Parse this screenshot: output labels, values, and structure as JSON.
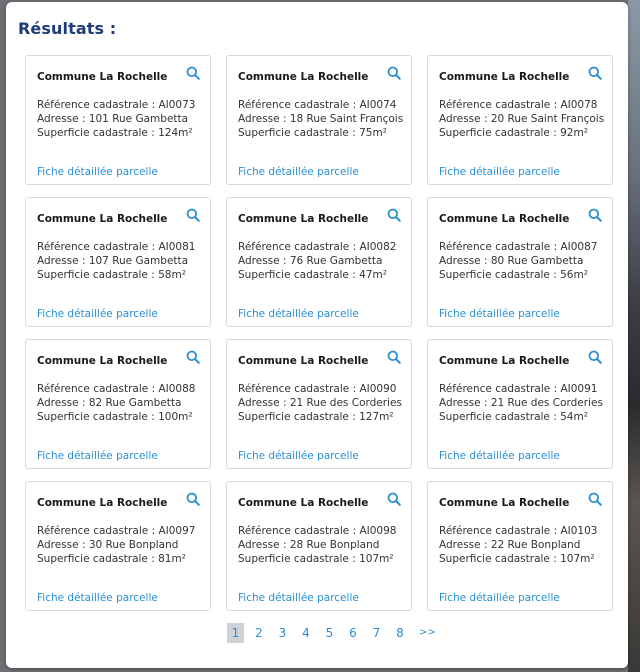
{
  "results": {
    "title": "Résultats :"
  },
  "cards": [
    {
      "commune": "Commune La Rochelle",
      "reference": "Référence cadastrale : AI0073",
      "adresse": "Adresse : 101 Rue Gambetta",
      "superficie": "Superficie cadastrale : 124m²",
      "link": "Fiche détaillée parcelle"
    },
    {
      "commune": "Commune La Rochelle",
      "reference": "Référence cadastrale : AI0074",
      "adresse": "Adresse : 18 Rue Saint François",
      "superficie": "Superficie cadastrale : 75m²",
      "link": "Fiche détaillée parcelle"
    },
    {
      "commune": "Commune La Rochelle",
      "reference": "Référence cadastrale : AI0078",
      "adresse": "Adresse : 20 Rue Saint François",
      "superficie": "Superficie cadastrale : 92m²",
      "link": "Fiche détaillée parcelle"
    },
    {
      "commune": "Commune La Rochelle",
      "reference": "Référence cadastrale : AI0081",
      "adresse": "Adresse : 107 Rue Gambetta",
      "superficie": "Superficie cadastrale : 58m²",
      "link": "Fiche détaillée parcelle"
    },
    {
      "commune": "Commune La Rochelle",
      "reference": "Référence cadastrale : AI0082",
      "adresse": "Adresse : 76 Rue Gambetta",
      "superficie": "Superficie cadastrale : 47m²",
      "link": "Fiche détaillée parcelle"
    },
    {
      "commune": "Commune La Rochelle",
      "reference": "Référence cadastrale : AI0087",
      "adresse": "Adresse : 80 Rue Gambetta",
      "superficie": "Superficie cadastrale : 56m²",
      "link": "Fiche détaillée parcelle"
    },
    {
      "commune": "Commune La Rochelle",
      "reference": "Référence cadastrale : AI0088",
      "adresse": "Adresse : 82 Rue Gambetta",
      "superficie": "Superficie cadastrale : 100m²",
      "link": "Fiche détaillée parcelle"
    },
    {
      "commune": "Commune La Rochelle",
      "reference": "Référence cadastrale : AI0090",
      "adresse": "Adresse : 21 Rue des Corderies",
      "superficie": "Superficie cadastrale : 127m²",
      "link": "Fiche détaillée parcelle"
    },
    {
      "commune": "Commune La Rochelle",
      "reference": "Référence cadastrale : AI0091",
      "adresse": "Adresse : 21 Rue des Corderies",
      "superficie": "Superficie cadastrale : 54m²",
      "link": "Fiche détaillée parcelle"
    },
    {
      "commune": "Commune La Rochelle",
      "reference": "Référence cadastrale : AI0097",
      "adresse": "Adresse : 30 Rue Bonpland",
      "superficie": "Superficie cadastrale : 81m²",
      "link": "Fiche détaillée parcelle"
    },
    {
      "commune": "Commune La Rochelle",
      "reference": "Référence cadastrale : AI0098",
      "adresse": "Adresse : 28 Rue Bonpland",
      "superficie": "Superficie cadastrale : 107m²",
      "link": "Fiche détaillée parcelle"
    },
    {
      "commune": "Commune La Rochelle",
      "reference": "Référence cadastrale : AI0103",
      "adresse": "Adresse : 22 Rue Bonpland",
      "superficie": "Superficie cadastrale : 107m²",
      "link": "Fiche détaillée parcelle"
    }
  ],
  "pagination": {
    "pages": [
      "1",
      "2",
      "3",
      "4",
      "5",
      "6",
      "7",
      "8"
    ],
    "current": "1",
    "next_label": ">>"
  },
  "icons": {
    "card_action": "search-icon"
  },
  "colors": {
    "title": "#1f3b78",
    "link": "#2a8fd0",
    "active_page_bg": "#cfd2d6"
  }
}
